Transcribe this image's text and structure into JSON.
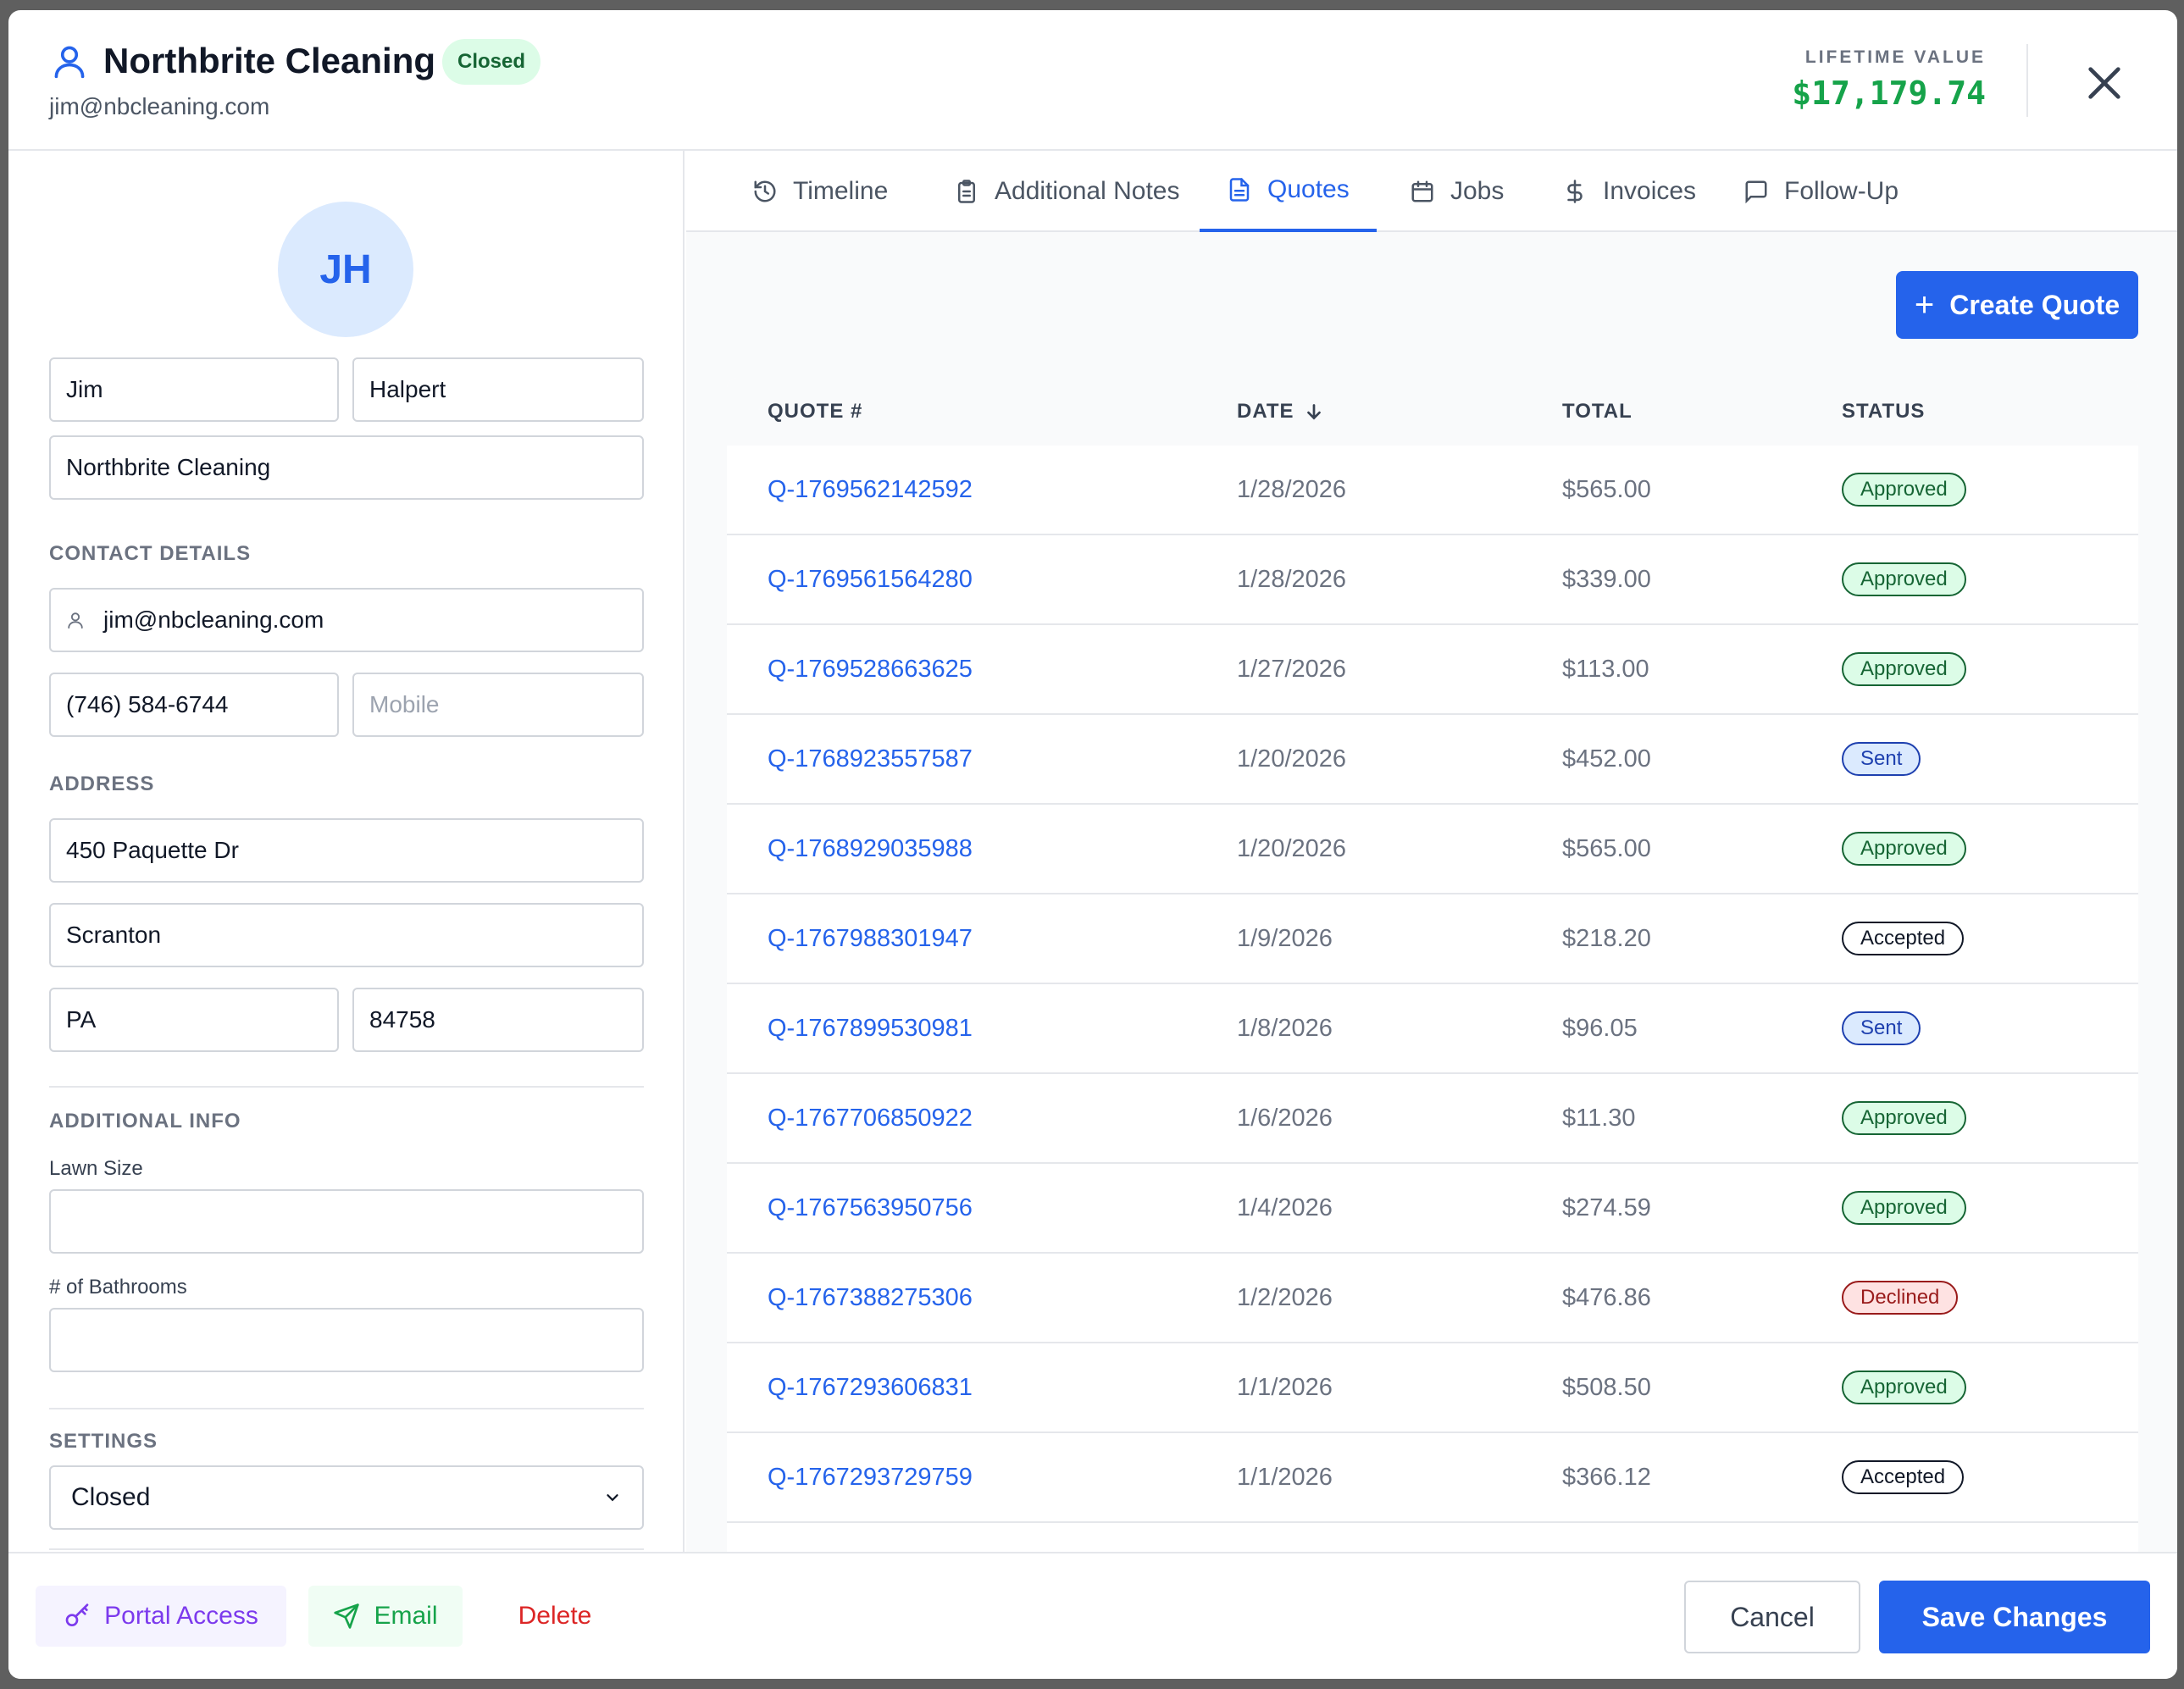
{
  "header": {
    "title": "Northbrite Cleaning",
    "status_badge": "Closed",
    "email": "jim@nbcleaning.com",
    "lifetime_label": "LIFETIME VALUE",
    "lifetime_value": "$17,179.74"
  },
  "profile": {
    "initials": "JH",
    "first_name": "Jim",
    "last_name": "Halpert",
    "company": "Northbrite Cleaning"
  },
  "contact": {
    "section_label": "CONTACT DETAILS",
    "email": "jim@nbcleaning.com",
    "phone": "(746) 584-6744",
    "mobile_placeholder": "Mobile"
  },
  "address": {
    "section_label": "ADDRESS",
    "street": "450 Paquette Dr",
    "city": "Scranton",
    "state": "PA",
    "zip": "84758"
  },
  "additional": {
    "section_label": "ADDITIONAL INFO",
    "lawn_size_label": "Lawn Size",
    "lawn_size_value": "",
    "bathrooms_label": "# of Bathrooms",
    "bathrooms_value": ""
  },
  "settings": {
    "section_label": "SETTINGS",
    "status_value": "Closed"
  },
  "tabs": [
    {
      "label": "Timeline",
      "icon": "history-icon"
    },
    {
      "label": "Additional Notes",
      "icon": "clipboard-icon"
    },
    {
      "label": "Quotes",
      "icon": "document-icon",
      "active": true
    },
    {
      "label": "Jobs",
      "icon": "calendar-icon"
    },
    {
      "label": "Invoices",
      "icon": "dollar-icon"
    },
    {
      "label": "Follow-Up",
      "icon": "message-icon"
    }
  ],
  "quotes": {
    "create_label": "Create Quote",
    "columns": [
      "QUOTE #",
      "DATE",
      "TOTAL",
      "STATUS"
    ],
    "rows": [
      {
        "id": "Q-1769562142592",
        "date": "1/28/2026",
        "total": "$565.00",
        "status": "Approved"
      },
      {
        "id": "Q-1769561564280",
        "date": "1/28/2026",
        "total": "$339.00",
        "status": "Approved"
      },
      {
        "id": "Q-1769528663625",
        "date": "1/27/2026",
        "total": "$113.00",
        "status": "Approved"
      },
      {
        "id": "Q-1768923557587",
        "date": "1/20/2026",
        "total": "$452.00",
        "status": "Sent"
      },
      {
        "id": "Q-1768929035988",
        "date": "1/20/2026",
        "total": "$565.00",
        "status": "Approved"
      },
      {
        "id": "Q-1767988301947",
        "date": "1/9/2026",
        "total": "$218.20",
        "status": "Accepted"
      },
      {
        "id": "Q-1767899530981",
        "date": "1/8/2026",
        "total": "$96.05",
        "status": "Sent"
      },
      {
        "id": "Q-1767706850922",
        "date": "1/6/2026",
        "total": "$11.30",
        "status": "Approved"
      },
      {
        "id": "Q-1767563950756",
        "date": "1/4/2026",
        "total": "$274.59",
        "status": "Approved"
      },
      {
        "id": "Q-1767388275306",
        "date": "1/2/2026",
        "total": "$476.86",
        "status": "Declined"
      },
      {
        "id": "Q-1767293606831",
        "date": "1/1/2026",
        "total": "$508.50",
        "status": "Approved"
      },
      {
        "id": "Q-1767293729759",
        "date": "1/1/2026",
        "total": "$366.12",
        "status": "Accepted"
      }
    ]
  },
  "footer": {
    "portal_label": "Portal Access",
    "email_label": "Email",
    "delete_label": "Delete",
    "cancel_label": "Cancel",
    "save_label": "Save Changes"
  },
  "colors": {
    "accent": "#2563eb",
    "success": "#16a34a",
    "danger": "#dc2626",
    "portal": "#7c3aed"
  }
}
